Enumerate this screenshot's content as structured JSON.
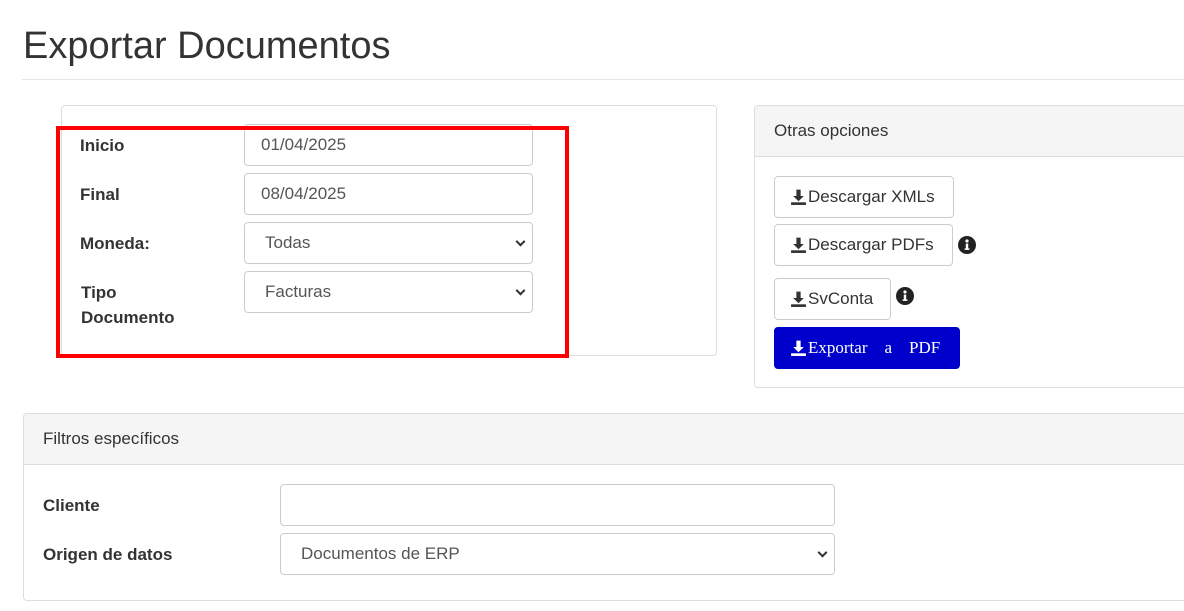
{
  "page": {
    "title": "Exportar Documentos"
  },
  "dates": {
    "start_label": "Inicio",
    "start_value": "01/04/2025",
    "end_label": "Final",
    "end_value": "08/04/2025",
    "currency_label": "Moneda:",
    "currency_value": "Todas",
    "doc_type_label_line1": "Tipo",
    "doc_type_label_line2": "Documento",
    "doc_type_value": "Facturas"
  },
  "options": {
    "heading": "Otras opciones",
    "download_xmls": "Descargar XMLs",
    "download_pdfs": "Descargar PDFs",
    "svconta": "SvConta",
    "export_pdf": "Exportar a PDF",
    "export_pdf_parts": [
      "Exportar",
      "a",
      "PDF"
    ]
  },
  "filters": {
    "heading": "Filtros específicos",
    "client_label": "Cliente",
    "client_value": "",
    "source_label": "Origen de datos",
    "source_value": "Documentos de ERP"
  },
  "colors": {
    "highlight": "#ff0000",
    "primary_button": "#0000cc",
    "panel_header": "#f5f5f5"
  },
  "icons": {
    "download": "download-icon",
    "info": "info-circle-icon",
    "dropdown": "chevron-down-icon"
  }
}
